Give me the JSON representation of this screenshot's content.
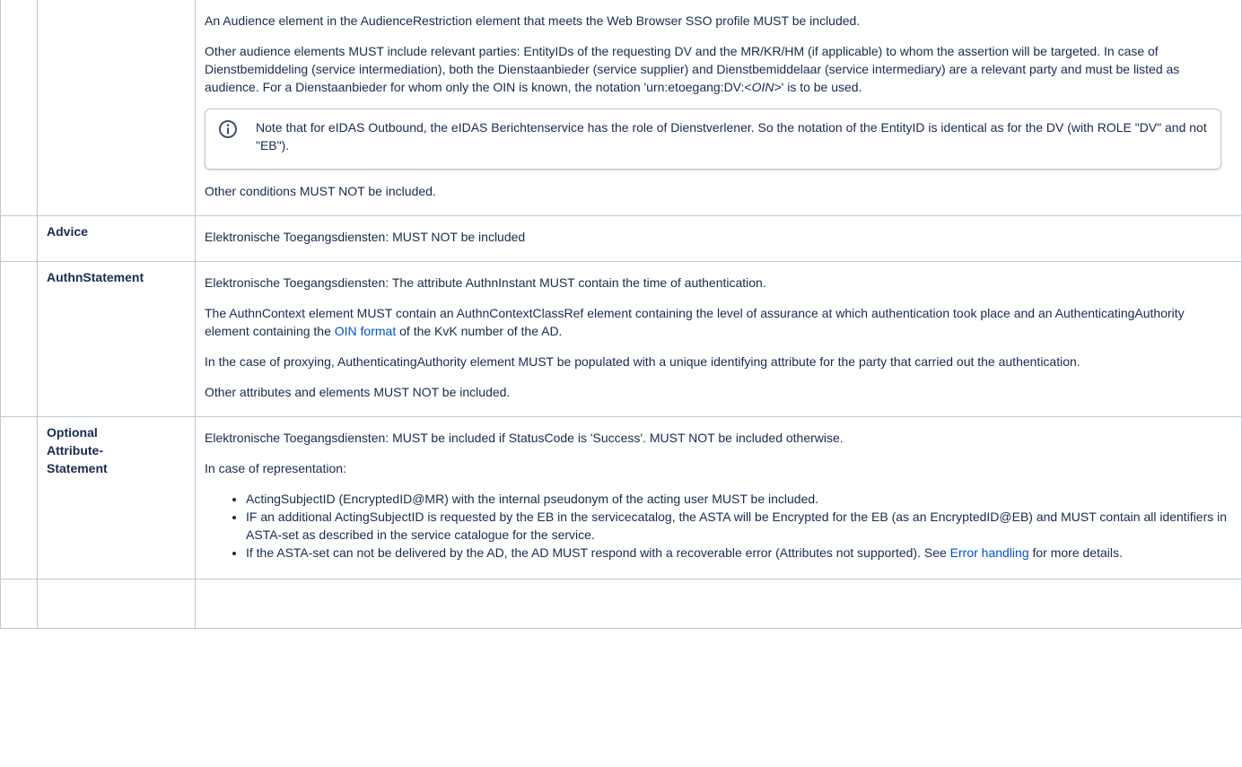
{
  "rows": {
    "audience": {
      "p1": "An Audience element in the AudienceRestriction element that meets the Web Browser SSO profile MUST be included.",
      "p2_a": "Other audience elements MUST include relevant parties: EntityIDs of the requesting DV and the MR/KR/HM (if applicable) to whom the assertion will be targeted. In case of Dienstbemiddeling (service intermediation), both the Dienstaanbieder (service supplier) and Dienstbemiddelaar (service intermediary) are a relevant party and must be listed as audience. For a Dienstaanbieder for whom only the OIN is known, the notation 'urn:etoegang:DV:<",
      "p2_em": "OIN",
      "p2_b": ">' is to be used.",
      "note_icon": "info-icon",
      "note_text": "Note that for eIDAS Outbound, the eIDAS Berichtenservice has the role of Dienstverlener. So the notation of the EntityID is identical as for the DV (with ROLE \"DV\" and not \"EB\").",
      "p3": "Other conditions MUST NOT be included."
    },
    "advice": {
      "name": "Advice",
      "p1": "Elektronische Toegangsdiensten: MUST NOT be included"
    },
    "authn": {
      "name": "AuthnStatement",
      "p1": "Elektronische Toegangsdiensten: The attribute AuthnInstant MUST contain the time of authentication.",
      "p2_a": "The AuthnContext element MUST contain an AuthnContextClassRef element containing the level of assurance at which authentication took place and an AuthenticatingAuthority element containing the ",
      "p2_link": "OIN format",
      "p2_b": " of the KvK number of the AD.",
      "p3": "In the case of proxying, AuthenticatingAuthority element MUST be populated with a unique identifying attribute for the party that carried out the authentication.",
      "p4": "Other attributes and elements MUST NOT be included."
    },
    "attr": {
      "name_1": "Optional",
      "name_2": "Attribute-",
      "name_3": "Statement",
      "p1": "Elektronische Toegangsdiensten: MUST be included if StatusCode is 'Success'. MUST NOT be included otherwise.",
      "p2": "In case of representation:",
      "b1": "ActingSubjectID (EncryptedID@MR) with the internal pseudonym of the acting user MUST be included.",
      "b2": "IF an additional ActingSubjectID is requested by the EB in the servicecatalog, the ASTA will be Encrypted for the EB (as an EncryptedID@EB) and MUST contain all identifiers in ASTA-set as described in the service catalogue for the service.",
      "b3_a": "If the ASTA-set can not be delivered by the AD, the AD MUST respond with a recoverable error (Attributes not supported). See ",
      "b3_link": "Error handling",
      "b3_b": " for more details."
    }
  },
  "colors": {
    "link": "#0052cc",
    "border": "#c1c7d0",
    "text": "#172b4d"
  }
}
